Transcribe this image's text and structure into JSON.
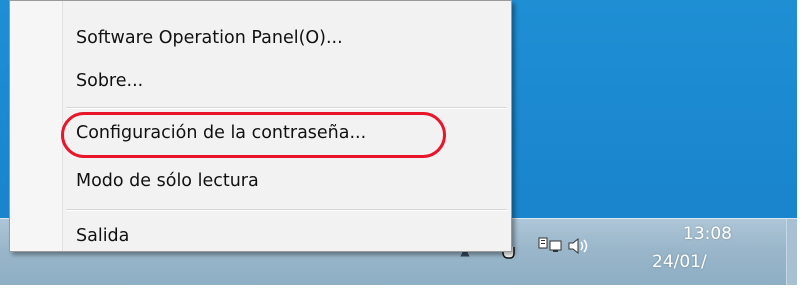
{
  "context_menu": {
    "items": [
      {
        "label": "Software Operation Panel(O)..."
      },
      {
        "label": "Sobre..."
      },
      {
        "label": "Configuración de la contraseña..."
      },
      {
        "label": "Modo de sólo lectura"
      },
      {
        "label": "Salida"
      }
    ],
    "highlighted_item_index": 2,
    "highlight_color": "#e8152b"
  },
  "taskbar": {
    "clock": {
      "time": "13:08",
      "date": "24/01/"
    },
    "tray_icons": [
      "show-hidden-icons-chevron",
      "scanner-app-icon",
      "network-icon",
      "volume-icon"
    ]
  },
  "colors": {
    "desktop": "#1a86ce",
    "taskbar": "#9ab6ca",
    "menu_background": "#f2f2f2"
  }
}
